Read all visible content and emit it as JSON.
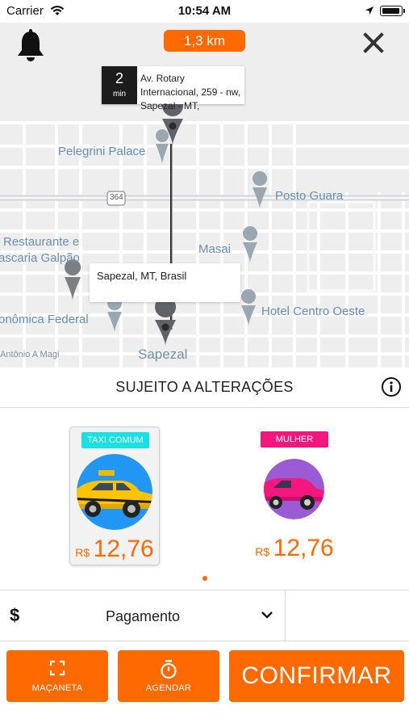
{
  "status_bar": {
    "carrier": "Carrier",
    "time": "10:54 AM"
  },
  "map": {
    "distance": "1,3 km",
    "eta": {
      "value": "2",
      "unit": "min",
      "address": "Av. Rotary Internacional, 259 - nw, Sapezal - MT,"
    },
    "destination_label": "Sapezal, MT, Brasil",
    "pois": {
      "pelegrini": "Pelegrini Palace",
      "posto": "Posto Guara",
      "restaurante_1": "Restaurante e",
      "restaurante_2": "ascaria Galpão",
      "masai": "Masai",
      "hotel": "Hotel Centro Oeste",
      "federal": "onômica Federal",
      "street": "Antônio A Magi",
      "city": "Sapezal",
      "highway": "364"
    }
  },
  "notice": {
    "text": "SUJEITO A ALTERAÇÕES"
  },
  "options": [
    {
      "tag": "TAXI COMUM",
      "currency": "R$",
      "price": "12,76",
      "tag_color": "#18e0e3",
      "selected": true
    },
    {
      "tag": "MULHER",
      "currency": "R$",
      "price": "12,76",
      "tag_color": "#f4187e",
      "selected": false
    }
  ],
  "payment": {
    "symbol": "$",
    "label": "Pagamento"
  },
  "buttons": {
    "handle": "MAÇANETA",
    "schedule": "AGENDAR",
    "confirm": "CONFIRMAR"
  },
  "colors": {
    "accent": "#ff6a00",
    "map_bg": "#eeeeef",
    "poi_text": "#6b8fad"
  },
  "icons": [
    "bell-icon",
    "close-icon",
    "info-icon",
    "chevron-down-icon",
    "expand-icon",
    "timer-icon",
    "map-pin-icon"
  ]
}
